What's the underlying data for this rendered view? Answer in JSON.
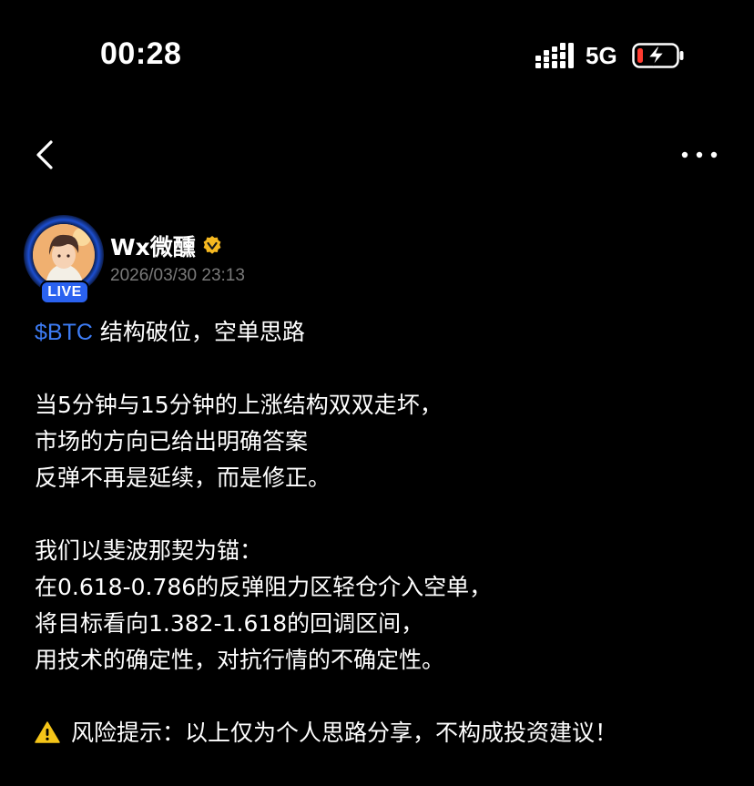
{
  "status_bar": {
    "time": "00:28",
    "network": "5G",
    "icons": [
      "signal-icon",
      "battery-charging-icon"
    ]
  },
  "nav": {
    "icons": [
      "back-chevron-icon",
      "more-dots-icon"
    ]
  },
  "author": {
    "name": "Wx微醺",
    "badge": "LIVE",
    "timestamp": "2026/03/30 23:13",
    "verified_icon": "verified-badge-icon"
  },
  "post": {
    "ticker": "$BTC",
    "title_rest": " 结构破位，空单思路",
    "paragraph1": [
      "当5分钟与15分钟的上涨结构双双走坏，",
      "市场的方向已给出明确答案",
      "反弹不再是延续，而是修正。"
    ],
    "paragraph2": [
      "我们以斐波那契为锚：",
      "在0.618-0.786的反弹阻力区轻仓介入空单，",
      "将目标看向1.382-1.618的回调区间，",
      "用技术的确定性，对抗行情的不确定性。"
    ],
    "risk_note": "风险提示：以上仅为个人思路分享，不构成投资建议！"
  },
  "colors": {
    "background": "#000000",
    "ticker": "#3d7cf5",
    "live_badge": "#2a62f0",
    "verified": "#f5b820",
    "battery_low": "#ff3b30",
    "timestamp": "#7a7a7a"
  }
}
